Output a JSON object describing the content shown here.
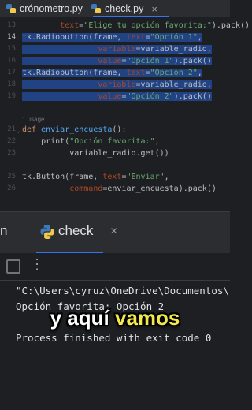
{
  "tabs": [
    {
      "label": "crónometro.py",
      "close": "×"
    },
    {
      "label": "check.py",
      "close": "×"
    }
  ],
  "colors": {
    "background": "#1e1f22",
    "panel": "#2b2d30",
    "accent": "#3574f0",
    "selection": "#214283",
    "keyword": "#cf8e6d",
    "function": "#56a8f5",
    "string": "#6aab73",
    "parameter": "#aa4926",
    "subtitle_highlight": "#f4e94a"
  },
  "editor": {
    "gutter": [
      "13",
      "14",
      "15",
      "16",
      "17",
      "18",
      "19",
      "",
      "21",
      "22",
      "23",
      "",
      "25",
      "26"
    ],
    "usage_hint": "1 usage",
    "lines": {
      "l13_a": "        ",
      "l13_param": "text",
      "l13_b": "=",
      "l13_str": "\"Elige tu opción favorita:\"",
      "l13_c": ").pack()",
      "l14_a": "tk.Radiobutton(frame, ",
      "l14_param": "text",
      "l14_b": "=",
      "l14_str": "\"Opción 1\"",
      "l14_c": ",",
      "l15_a": "                ",
      "l15_param": "variable",
      "l15_b": "=variable_radio,",
      "l16_a": "                ",
      "l16_param": "value",
      "l16_b": "=",
      "l16_str": "\"Opción 1\"",
      "l16_c": ").pack()",
      "l17_a": "tk.Radiobutton(frame, ",
      "l17_param": "text",
      "l17_b": "=",
      "l17_str": "\"Opción 2\"",
      "l17_c": ",",
      "l18_a": "                ",
      "l18_param": "variable",
      "l18_b": "=variable_radio,",
      "l19_a": "                ",
      "l19_param": "value",
      "l19_b": "=",
      "l19_str": "\"Opción 2\"",
      "l19_c": ").pack()",
      "l21_kw": "def ",
      "l21_fn": "enviar_encuesta",
      "l21_c": "():",
      "l22_a": "    print(",
      "l22_str": "\"Opción favorita:\"",
      "l22_c": ",",
      "l23_a": "          variable_radio.get())",
      "l25_a": "tk.Button(frame, ",
      "l25_param": "text",
      "l25_b": "=",
      "l25_str": "\"Enviar\"",
      "l25_c": ",",
      "l26_a": "          ",
      "l26_param": "command",
      "l26_b": "=enviar_encuesta).pack()"
    }
  },
  "run": {
    "label": "n",
    "tab_title": "check",
    "close": "×",
    "more": "⋮",
    "console": [
      "\"C:\\Users\\cyruz\\OneDrive\\Documentos\\",
      "Opción favorita: Opción 2",
      "Process finished with exit code 0"
    ]
  },
  "subtitle": {
    "prefix": "y aquí ",
    "highlight": "vamos"
  }
}
